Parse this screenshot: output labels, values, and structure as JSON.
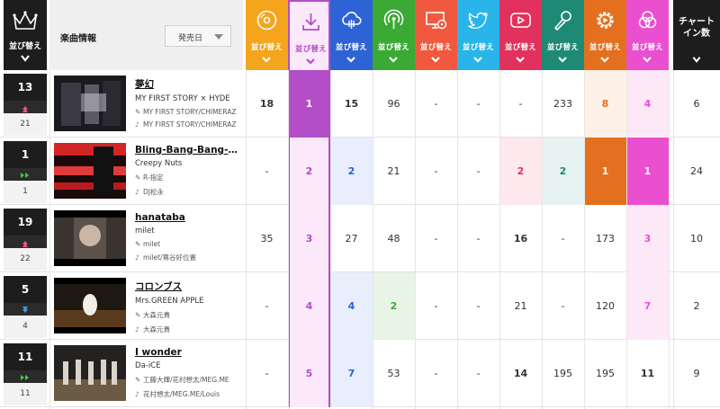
{
  "header": {
    "rank_label": "並び替え",
    "info_title": "楽曲情報",
    "sort_select": "発売日",
    "chart_in_label_1": "チャート",
    "chart_in_label_2": "イン数",
    "columns": [
      {
        "icon": "cd-icon",
        "label": "並び替え",
        "color": "#f5a51c"
      },
      {
        "icon": "download-icon",
        "label": "並び替え",
        "color": "#b44dc8"
      },
      {
        "icon": "cloud-stream-icon",
        "label": "並び替え",
        "color": "#2e63d6"
      },
      {
        "icon": "podcast-radio-icon",
        "label": "並び替え",
        "color": "#3aaa35"
      },
      {
        "icon": "pc-disc-icon",
        "label": "並び替え",
        "color": "#f0593e"
      },
      {
        "icon": "twitter-icon",
        "label": "並び替え",
        "color": "#29b5ea"
      },
      {
        "icon": "video-play-icon",
        "label": "並び替え",
        "color": "#e2315c"
      },
      {
        "icon": "microphone-icon",
        "label": "並び替え",
        "color": "#1e8a76"
      },
      {
        "icon": "gear-play-icon",
        "label": "並び替え",
        "color": "#e4701f"
      },
      {
        "icon": "venn-icon",
        "label": "並び替え",
        "color": "#ea4fcf"
      }
    ]
  },
  "rows": [
    {
      "rank": "13",
      "prev": "21",
      "move": "up",
      "title": "夢幻",
      "artist": "MY FIRST STORY × HYDE",
      "lyrics": "MY FIRST STORY/CHIMERAZ",
      "music": "MY FIRST STORY/CHIMERAZ",
      "cells": [
        "18",
        "1",
        "15",
        "96",
        "-",
        "-",
        "-",
        "233",
        "8",
        "4"
      ],
      "chart_in": "6"
    },
    {
      "rank": "1",
      "prev": "1",
      "move": "stay",
      "title": "Bling-Bang-Bang-Born",
      "artist": "Creepy Nuts",
      "lyrics": "R-指定",
      "music": "DJ松永",
      "cells": [
        "-",
        "2",
        "2",
        "21",
        "-",
        "-",
        "2",
        "2",
        "1",
        "1"
      ],
      "chart_in": "24"
    },
    {
      "rank": "19",
      "prev": "22",
      "move": "up",
      "title": "hanataba",
      "artist": "milet",
      "lyrics": "milet",
      "music": "milet/蔦谷好位置",
      "cells": [
        "35",
        "3",
        "27",
        "48",
        "-",
        "-",
        "16",
        "-",
        "173",
        "3"
      ],
      "chart_in": "10"
    },
    {
      "rank": "5",
      "prev": "4",
      "move": "down",
      "title": "コロンブス",
      "artist": "Mrs.GREEN APPLE",
      "lyrics": "大森元貴",
      "music": "大森元貴",
      "cells": [
        "-",
        "4",
        "4",
        "2",
        "-",
        "-",
        "21",
        "-",
        "120",
        "7"
      ],
      "chart_in": "2"
    },
    {
      "rank": "11",
      "prev": "11",
      "move": "stay",
      "title": "I wonder",
      "artist": "Da-iCE",
      "lyrics": "工藤大輝/花村想太/MEG.ME",
      "music": "花村想太/MEG.ME/Louis",
      "cells": [
        "-",
        "5",
        "7",
        "53",
        "-",
        "-",
        "14",
        "195",
        "195",
        "11"
      ],
      "chart_in": "9"
    }
  ]
}
